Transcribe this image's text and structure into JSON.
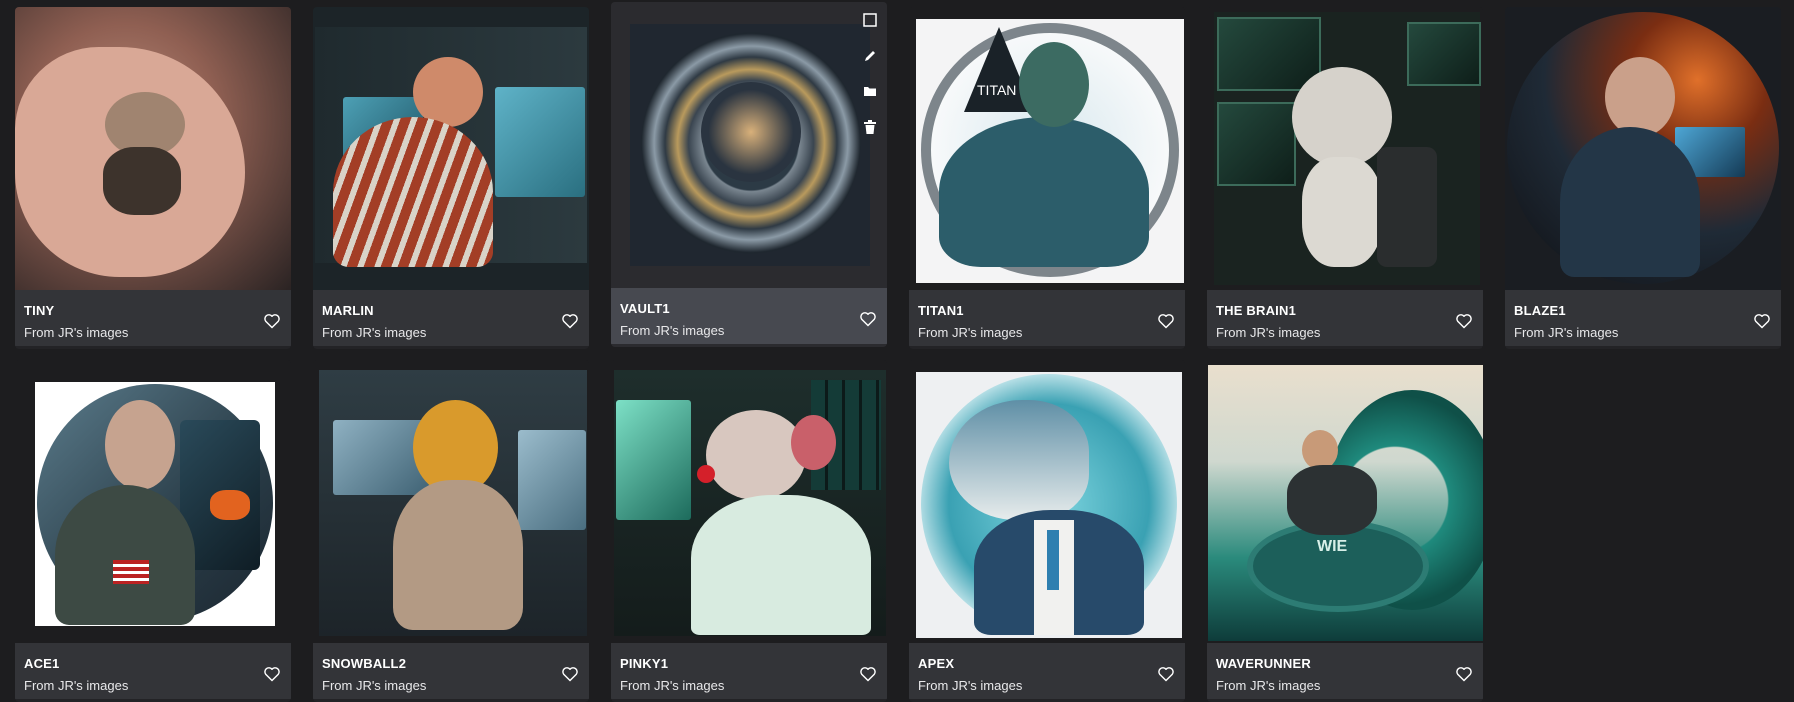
{
  "cards": [
    {
      "title": "TINY",
      "source": "From JR's images",
      "icon": "heart-icon"
    },
    {
      "title": "MARLIN",
      "source": "From JR's images",
      "icon": "heart-icon"
    },
    {
      "title": "VAULT1",
      "source": "From JR's images",
      "icon": "heart-icon"
    },
    {
      "title": "TITAN1",
      "source": "From JR's images",
      "icon": "heart-icon"
    },
    {
      "title": "THE BRAIN1",
      "source": "From JR's images",
      "icon": "heart-icon"
    },
    {
      "title": "BLAZE1",
      "source": "From JR's images",
      "icon": "heart-icon"
    },
    {
      "title": "ACE1",
      "source": "From JR's images",
      "icon": "heart-icon"
    },
    {
      "title": "SNOWBALL2",
      "source": "From JR's images",
      "icon": "heart-icon"
    },
    {
      "title": "PINKY1",
      "source": "From JR's images",
      "icon": "heart-icon"
    },
    {
      "title": "APEX",
      "source": "From JR's images",
      "icon": "heart-icon"
    },
    {
      "title": "WAVERUNNER",
      "source": "From JR's images",
      "icon": "heart-icon"
    }
  ],
  "hover_tools": [
    "select-checkbox-icon",
    "edit-pencil-icon",
    "folder-icon",
    "trash-icon"
  ],
  "titan_logo_text": "TITAN",
  "float_text": "WIE",
  "colors": {
    "background": "#1d1d1f",
    "footer": "#333438",
    "footer_hover": "#474950"
  }
}
